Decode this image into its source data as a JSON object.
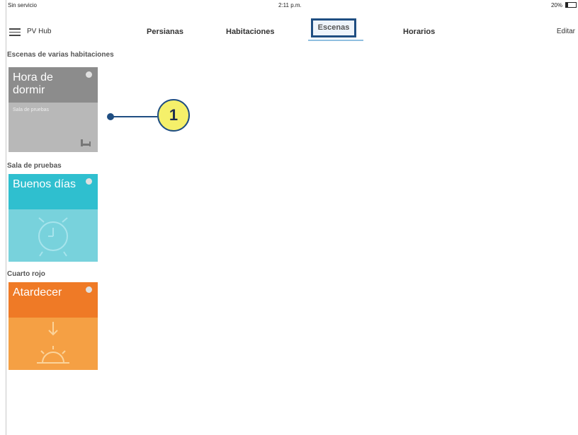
{
  "status_bar": {
    "carrier": "Sin servicio",
    "time": "2:11 p.m.",
    "battery_percent": "20%"
  },
  "nav": {
    "title": "PV Hub",
    "tabs": [
      {
        "label": "Persianas",
        "active": false
      },
      {
        "label": "Habitaciones",
        "active": false
      },
      {
        "label": "Escenas",
        "active": true
      },
      {
        "label": "Horarios",
        "active": false
      }
    ],
    "edit_label": "Editar"
  },
  "sections": [
    {
      "label": "Escenas de varias habitaciones",
      "scene": {
        "name": "Hora de dormir",
        "room": "Sala de pruebas",
        "icon": "bed-icon",
        "color_top": "#8c8c8c",
        "color_bottom": "#b8b8b8"
      }
    },
    {
      "label": "Sala de pruebas",
      "scene": {
        "name": "Buenos días",
        "icon": "alarm-clock-icon",
        "color_top": "#2fbfcf",
        "color_bottom": "#78d2dc"
      }
    },
    {
      "label": "Cuarto rojo",
      "scene": {
        "name": "Atardecer",
        "icon": "sunset-icon",
        "color_top": "#ef7a26",
        "color_bottom": "#f5a044"
      }
    }
  ],
  "callout": {
    "number": "1",
    "color": "#f5f06a",
    "border_color": "#1f4e82"
  }
}
